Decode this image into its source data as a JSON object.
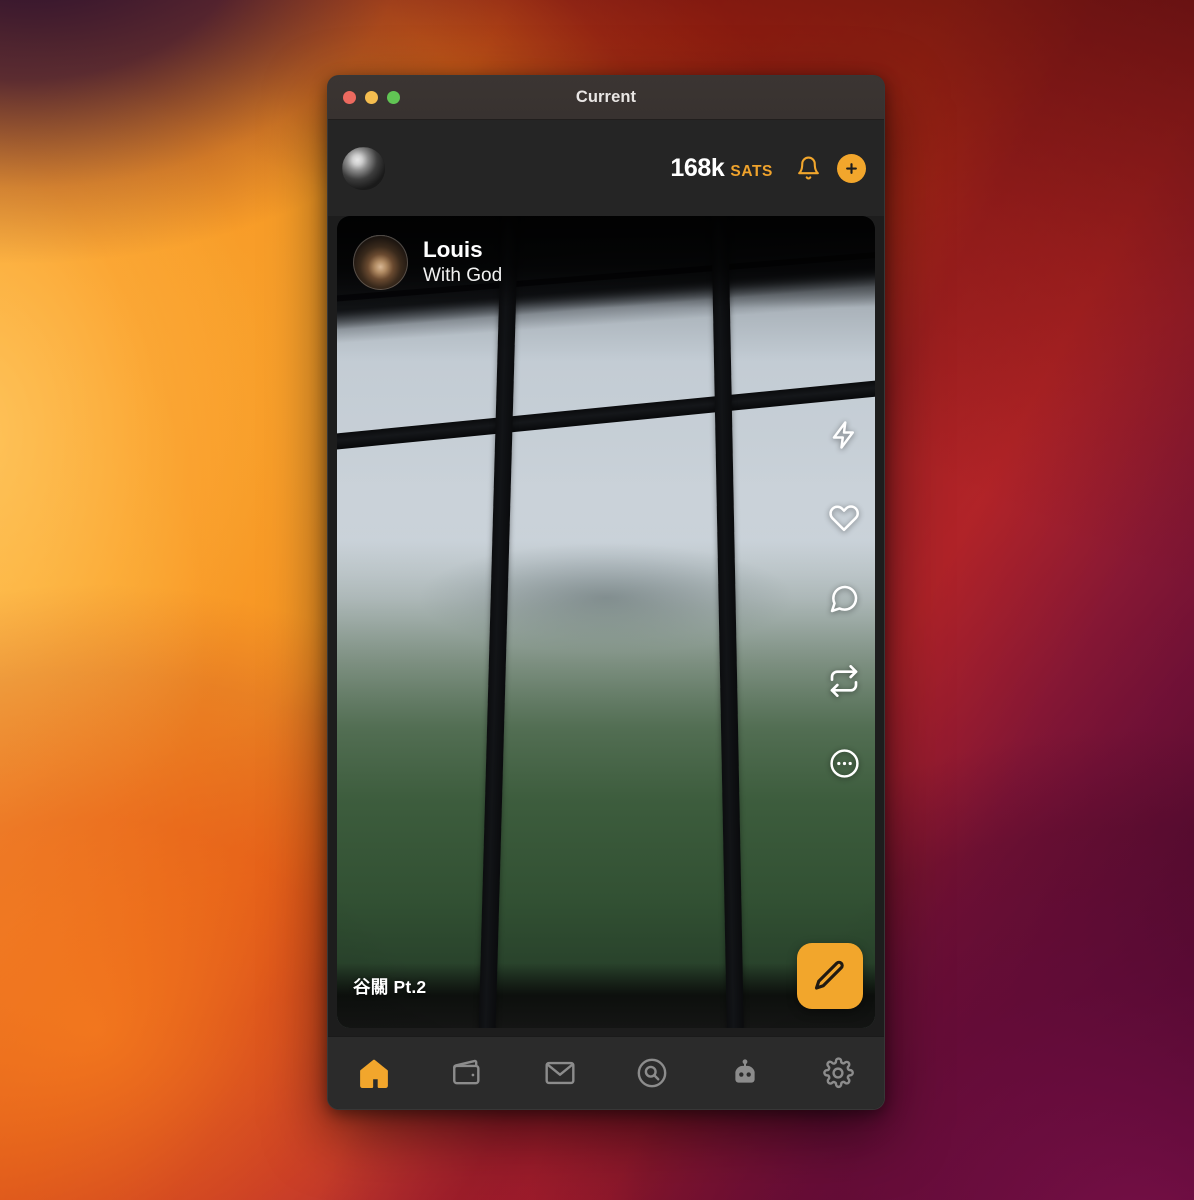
{
  "window": {
    "title": "Current",
    "traffic_lights": [
      {
        "name": "close",
        "color": "#ed6a5f"
      },
      {
        "name": "minimize",
        "color": "#f5bd4f"
      },
      {
        "name": "zoom",
        "color": "#61c554"
      }
    ]
  },
  "app_header": {
    "avatar_alt": "user-avatar",
    "sats_amount": "168k",
    "sats_unit": "SATS",
    "bell_icon": "bell-icon",
    "add_icon": "plus-icon"
  },
  "post": {
    "author": "Louis",
    "handle": "With God",
    "avatar_alt": "louis-avatar",
    "caption": "谷關 Pt.2",
    "media_alt": "photo-of-misty-forest-through-window",
    "actions": [
      {
        "name": "zap-icon",
        "label": "Zap"
      },
      {
        "name": "heart-icon",
        "label": "Like"
      },
      {
        "name": "comment-icon",
        "label": "Comment"
      },
      {
        "name": "repost-icon",
        "label": "Repost"
      },
      {
        "name": "more-icon",
        "label": "More"
      }
    ]
  },
  "compose": {
    "icon": "pencil-icon",
    "label": "Compose"
  },
  "bottom_nav": {
    "items": [
      {
        "name": "home",
        "icon": "home-icon",
        "label": "Home",
        "active": true
      },
      {
        "name": "wallet",
        "icon": "wallet-icon",
        "label": "Wallet",
        "active": false
      },
      {
        "name": "messages",
        "icon": "envelope-icon",
        "label": "Messages",
        "active": false
      },
      {
        "name": "search",
        "icon": "search-icon",
        "label": "Search",
        "active": false
      },
      {
        "name": "bots",
        "icon": "robot-icon",
        "label": "Bots",
        "active": false
      },
      {
        "name": "settings",
        "icon": "gear-icon",
        "label": "Settings",
        "active": false
      }
    ]
  },
  "colors": {
    "accent": "#f2a62c",
    "sats_text": "#ffffff",
    "sats_unit": "#f0a32c",
    "window_bg": "#1d1d1d",
    "titlebar_bg": "#3a3432",
    "nav_bg": "#2b2b2b",
    "nav_inactive": "#8c8c8c"
  }
}
